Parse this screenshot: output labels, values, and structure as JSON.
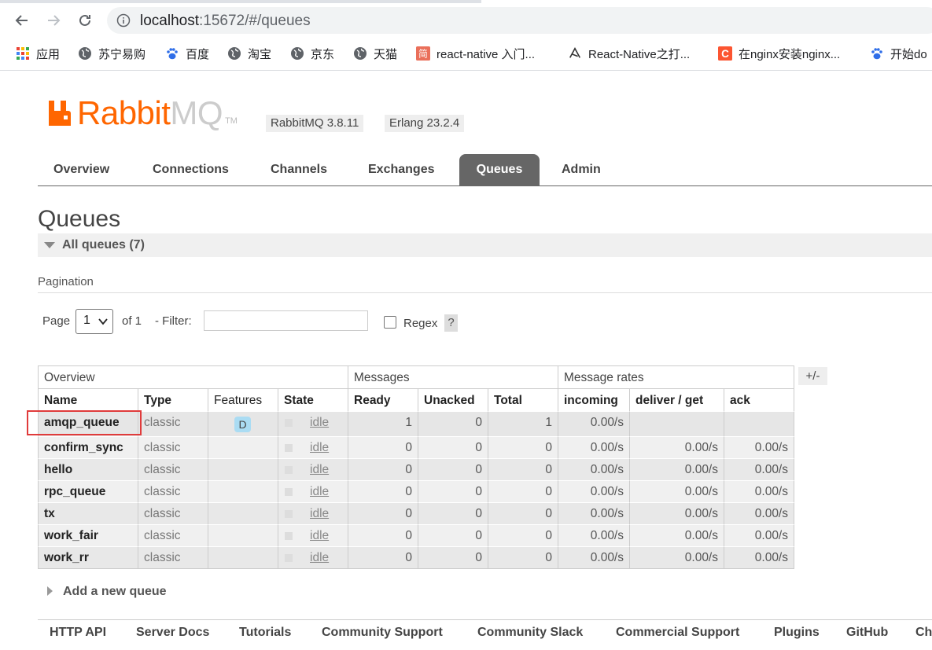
{
  "browser": {
    "url_host": "localhost",
    "url_rest": ":15672/#/queues",
    "bookmarks": [
      "应用",
      "苏宁易购",
      "百度",
      "淘宝",
      "京东",
      "天猫",
      "react-native 入门...",
      "React-Native之打...",
      "在nginx安装nginx...",
      "开始do"
    ],
    "bookmark_icons": [
      "apps-grid-icon",
      "globe-icon",
      "baidu-paw-icon",
      "globe-icon",
      "globe-icon",
      "globe-icon",
      "jianshu-icon",
      "react-native-icon",
      "csdn-icon",
      "baidu-paw-icon"
    ]
  },
  "app": {
    "logo_main": "Rabbit",
    "logo_mq": "MQ",
    "logo_tm": "TM",
    "version": "RabbitMQ 3.8.11",
    "erlang": "Erlang 23.2.4",
    "accent": "#ff6600"
  },
  "tabs": [
    "Overview",
    "Connections",
    "Channels",
    "Exchanges",
    "Queues",
    "Admin"
  ],
  "active_tab": "Queues",
  "page": {
    "title": "Queues",
    "section": "All queues (7)",
    "pagination_label": "Pagination",
    "page_label": "Page",
    "page_value": "1",
    "of_label": "of 1",
    "filter_label": "- Filter:",
    "filter_value": "",
    "regex_label": "Regex",
    "help": "?",
    "plus_minus": "+/-",
    "add_queue": "Add a new queue"
  },
  "table": {
    "groups": [
      "Overview",
      "Messages",
      "Message rates"
    ],
    "columns": [
      "Name",
      "Type",
      "Features",
      "State",
      "Ready",
      "Unacked",
      "Total",
      "incoming",
      "deliver / get",
      "ack"
    ],
    "rows": [
      {
        "name": "amqp_queue",
        "type": "classic",
        "features": "D",
        "state": "idle",
        "ready": "1",
        "unacked": "0",
        "total": "1",
        "incoming": "0.00/s",
        "deliver": "",
        "ack": ""
      },
      {
        "name": "confirm_sync",
        "type": "classic",
        "features": "",
        "state": "idle",
        "ready": "0",
        "unacked": "0",
        "total": "0",
        "incoming": "0.00/s",
        "deliver": "0.00/s",
        "ack": "0.00/s"
      },
      {
        "name": "hello",
        "type": "classic",
        "features": "",
        "state": "idle",
        "ready": "0",
        "unacked": "0",
        "total": "0",
        "incoming": "0.00/s",
        "deliver": "0.00/s",
        "ack": "0.00/s"
      },
      {
        "name": "rpc_queue",
        "type": "classic",
        "features": "",
        "state": "idle",
        "ready": "0",
        "unacked": "0",
        "total": "0",
        "incoming": "0.00/s",
        "deliver": "0.00/s",
        "ack": "0.00/s"
      },
      {
        "name": "tx",
        "type": "classic",
        "features": "",
        "state": "idle",
        "ready": "0",
        "unacked": "0",
        "total": "0",
        "incoming": "0.00/s",
        "deliver": "0.00/s",
        "ack": "0.00/s"
      },
      {
        "name": "work_fair",
        "type": "classic",
        "features": "",
        "state": "idle",
        "ready": "0",
        "unacked": "0",
        "total": "0",
        "incoming": "0.00/s",
        "deliver": "0.00/s",
        "ack": "0.00/s"
      },
      {
        "name": "work_rr",
        "type": "classic",
        "features": "",
        "state": "idle",
        "ready": "0",
        "unacked": "0",
        "total": "0",
        "incoming": "0.00/s",
        "deliver": "0.00/s",
        "ack": "0.00/s"
      }
    ]
  },
  "footer": [
    "HTTP API",
    "Server Docs",
    "Tutorials",
    "Community Support",
    "Community Slack",
    "Commercial Support",
    "Plugins",
    "GitHub",
    "Ch"
  ]
}
